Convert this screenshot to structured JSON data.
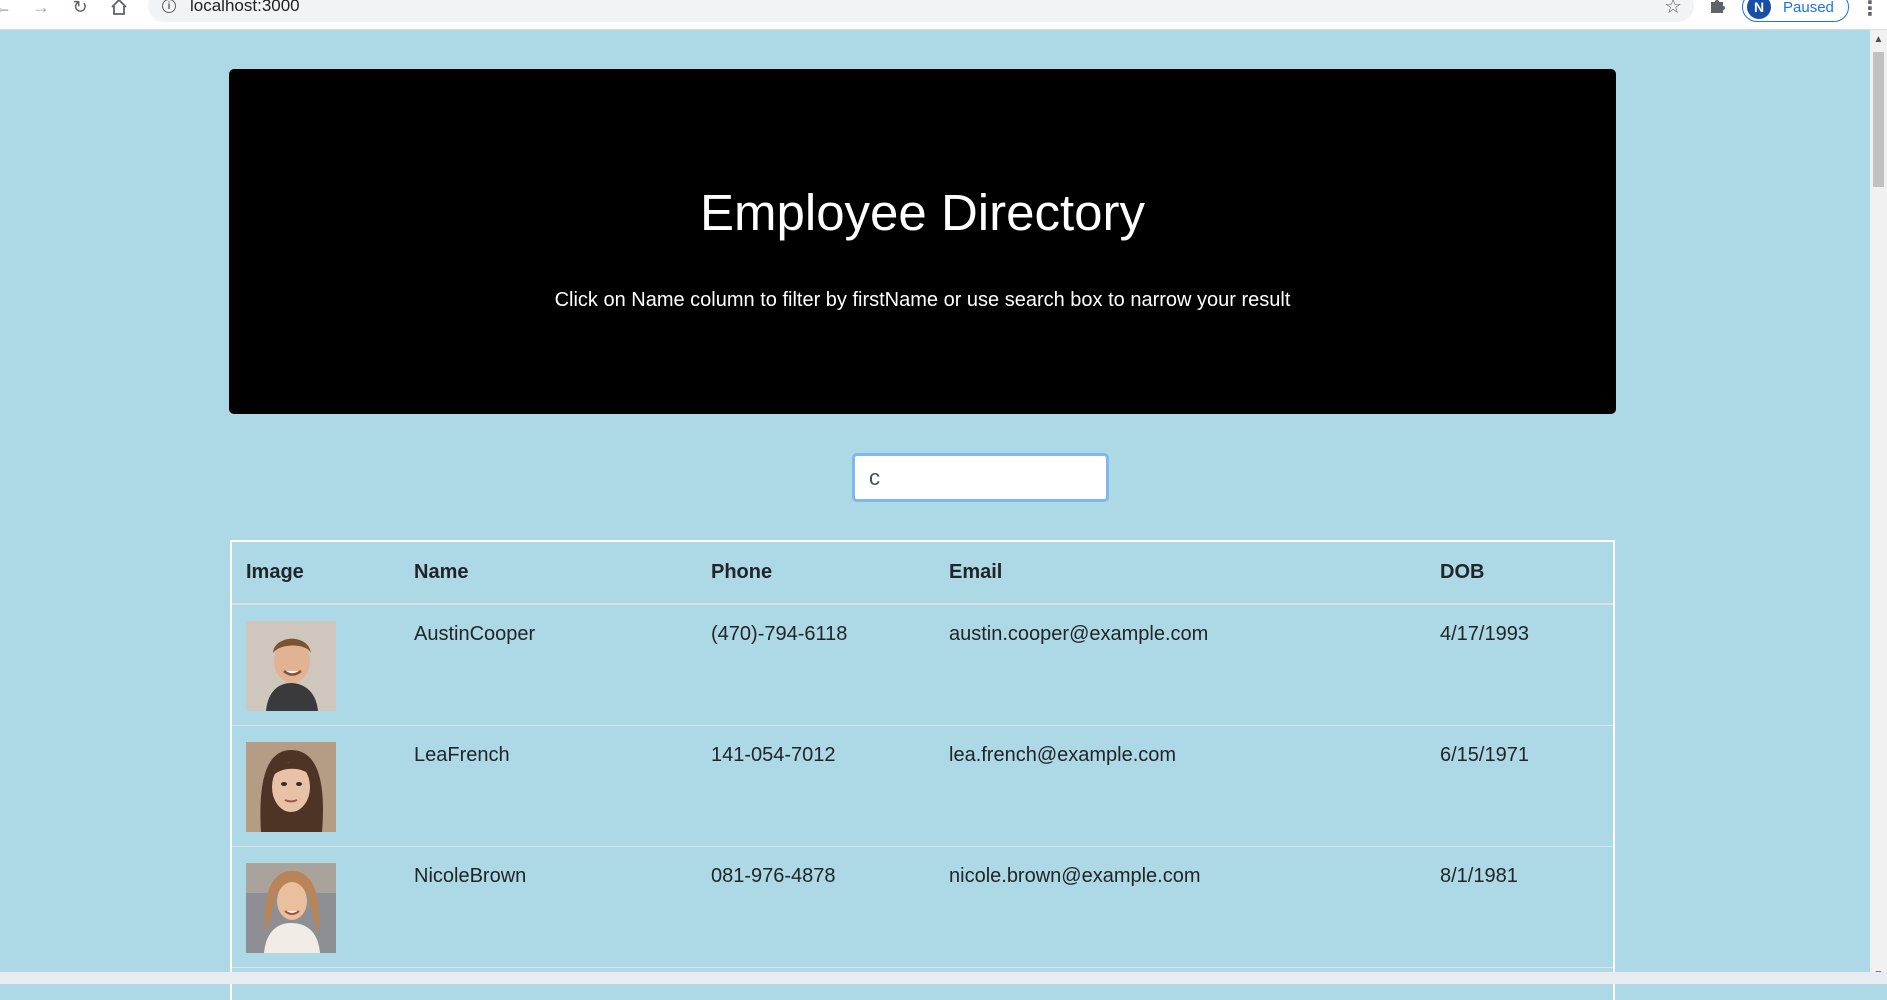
{
  "browser": {
    "url": "localhost:3000",
    "profile_initial": "N",
    "profile_status": "Paused"
  },
  "header": {
    "title": "Employee Directory",
    "subtitle": "Click on Name column to filter by firstName or use search box to narrow your result"
  },
  "search": {
    "value": "c",
    "placeholder": ""
  },
  "table": {
    "columns": [
      "Image",
      "Name",
      "Phone",
      "Email",
      "DOB"
    ],
    "rows": [
      {
        "name": "AustinCooper",
        "phone": "(470)-794-6118",
        "email": "austin.cooper@example.com",
        "dob": "4/17/1993"
      },
      {
        "name": "LeaFrench",
        "phone": "141-054-7012",
        "email": "lea.french@example.com",
        "dob": "6/15/1971"
      },
      {
        "name": "NicoleBrown",
        "phone": "081-976-4878",
        "email": "nicole.brown@example.com",
        "dob": "8/1/1981"
      }
    ]
  },
  "colors": {
    "page_background": "#add8e6",
    "jumbotron_background": "#000000",
    "focus_border": "#7fb7ee"
  },
  "icons": {
    "back": "arrow-left-icon",
    "forward": "arrow-right-icon",
    "reload": "reload-icon",
    "home": "home-icon",
    "info": "info-icon",
    "star": "star-icon",
    "extensions": "puzzle-icon",
    "menu": "kebab-menu-icon"
  }
}
